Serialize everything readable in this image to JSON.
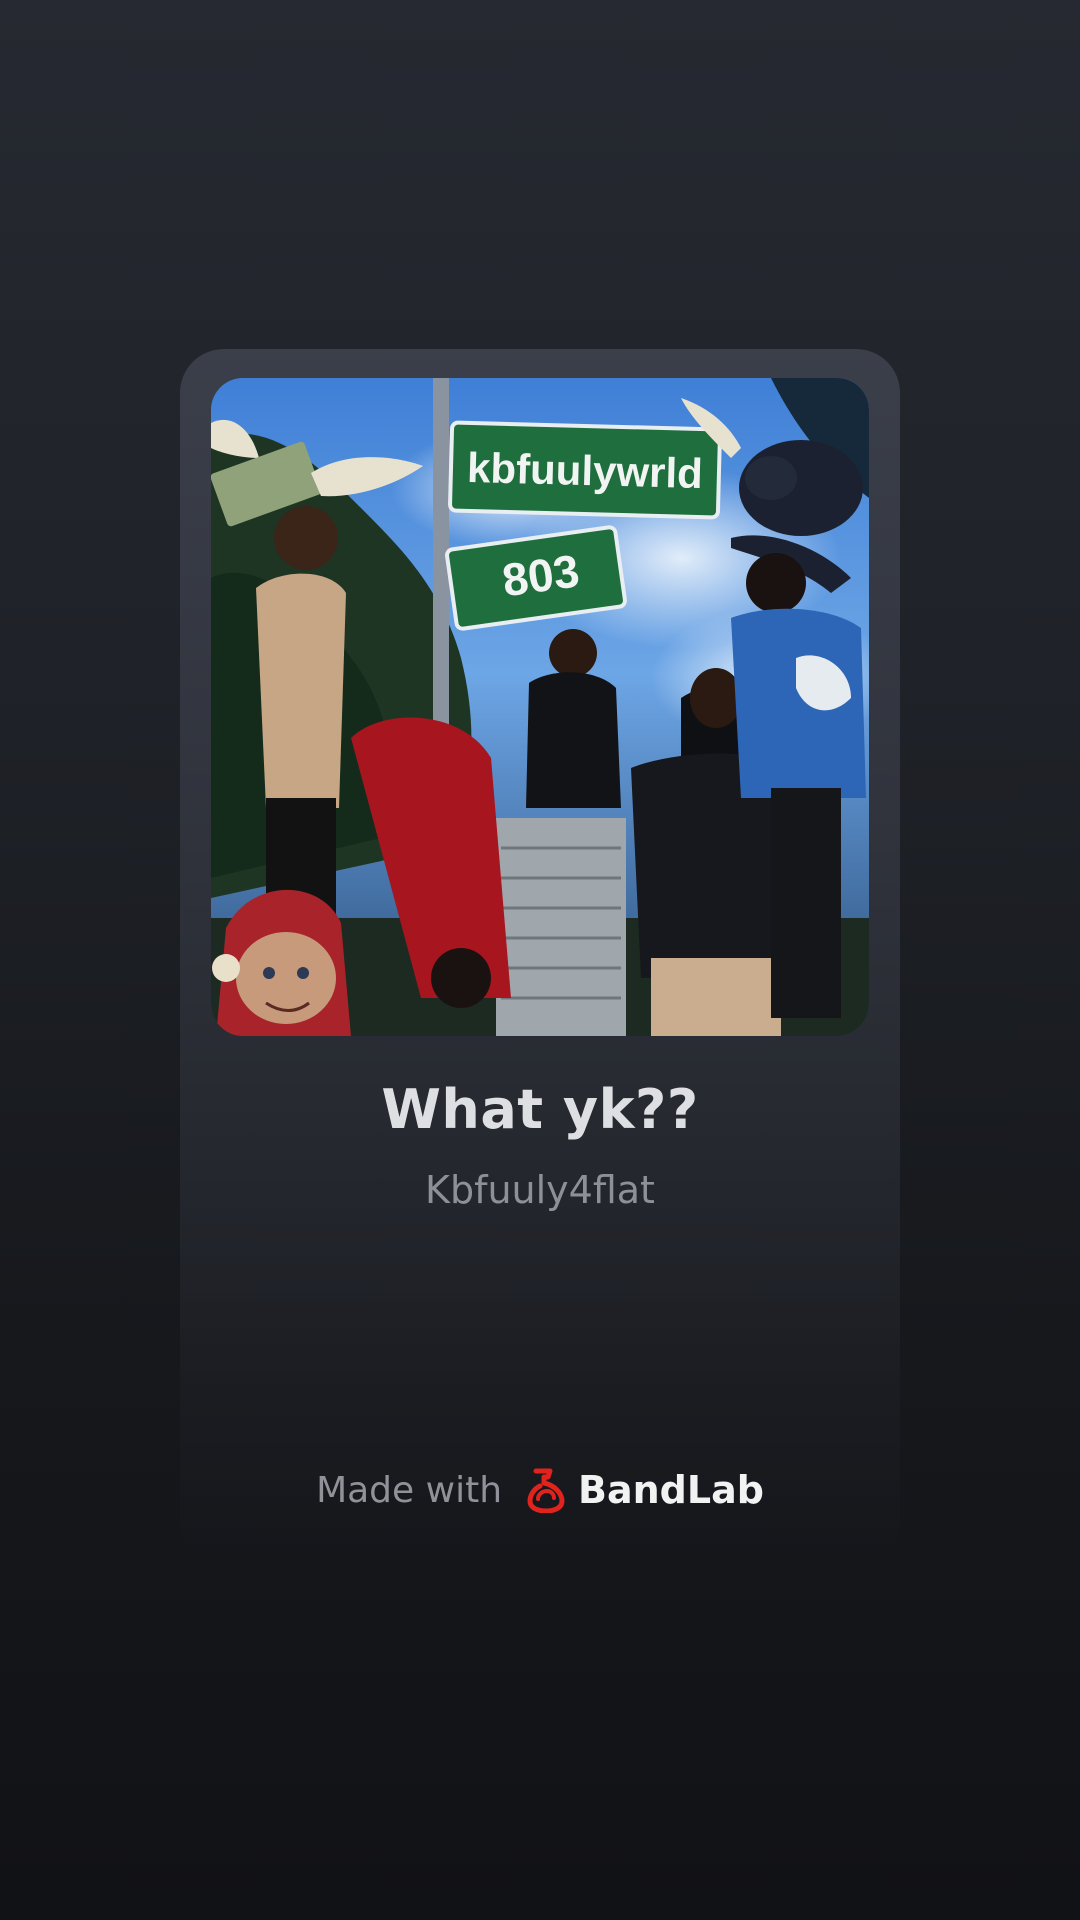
{
  "cover": {
    "street_sign_top": "kbfuulywrld",
    "street_sign_bottom": "803"
  },
  "track": {
    "title": "What yk??",
    "artist": "Kbfuuly4flat"
  },
  "footer": {
    "made_with": "Made with",
    "brand": "BandLab",
    "brand_icon": "bandlab-logo-icon",
    "brand_color": "#e0231c"
  }
}
